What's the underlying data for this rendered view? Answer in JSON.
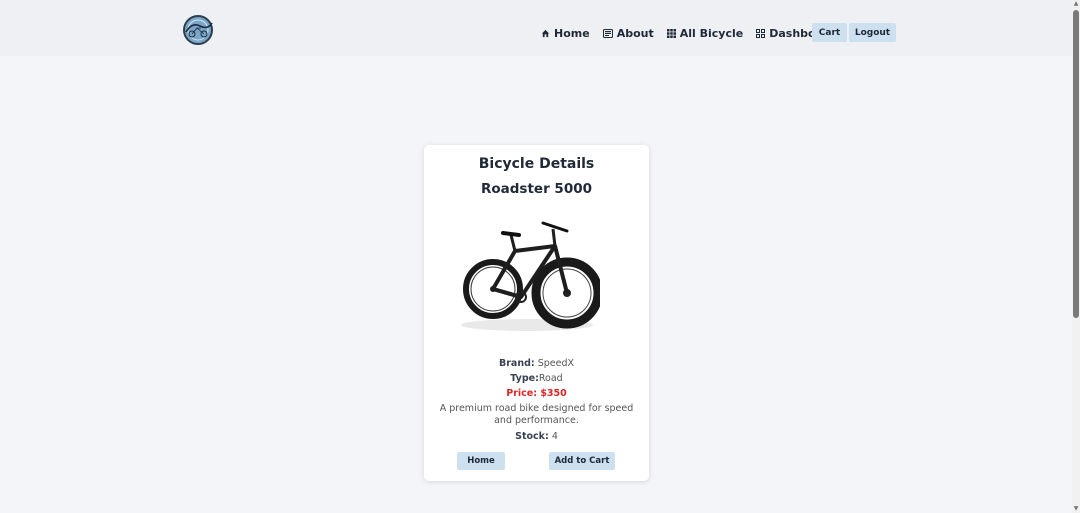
{
  "header": {
    "logo_alt": "Bicycle logo",
    "nav": [
      {
        "label": "Home",
        "icon": "home-icon"
      },
      {
        "label": "About",
        "icon": "about-icon"
      },
      {
        "label": "All Bicycle",
        "icon": "grid-icon"
      },
      {
        "label": "Dashboard",
        "icon": "dashboard-icon"
      }
    ],
    "cart_label": "Cart",
    "logout_label": "Logout"
  },
  "card": {
    "title": "Bicycle Details",
    "name": "Roadster 5000",
    "brand_label": "Brand:",
    "brand_value": "SpeedX",
    "type_label": "Type:",
    "type_value": "Road",
    "price": "Price: $350",
    "description": "A premium road bike designed for speed and performance.",
    "stock_label": "Stock:",
    "stock_value": "4",
    "home_button": "Home",
    "add_to_cart_button": "Add to Cart"
  },
  "colors": {
    "accent_button": "#cde0f0",
    "price": "#dc2626",
    "header_bg": "#eef0f3",
    "page_bg": "#f3f5f8"
  }
}
